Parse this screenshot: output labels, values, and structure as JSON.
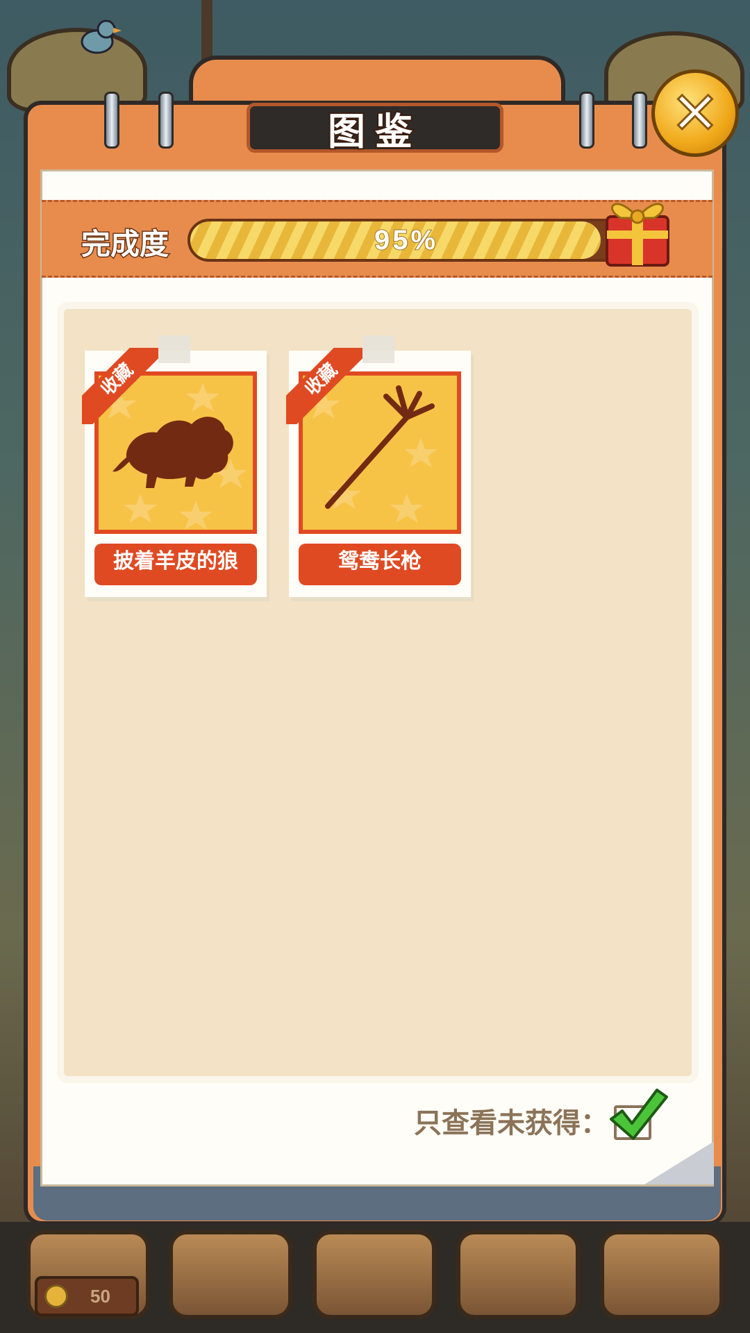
{
  "window": {
    "title": "图鉴"
  },
  "close": {
    "label": "✕"
  },
  "progress": {
    "label": "完成度",
    "value_text": "95%",
    "value": 0.95
  },
  "cards": [
    {
      "badge": "收藏",
      "name": "披着羊皮的狼",
      "icon": "wolf-silhouette-icon"
    },
    {
      "badge": "收藏",
      "name": "鸳鸯长枪",
      "icon": "spear-silhouette-icon"
    }
  ],
  "filter": {
    "label": "只查看未获得：",
    "checked": true
  },
  "footer": {
    "coins": "50"
  },
  "colors": {
    "accent": "#e88c4e",
    "card_red": "#e04a22",
    "card_gold": "#f7c347",
    "beige": "#f3e2c5"
  }
}
